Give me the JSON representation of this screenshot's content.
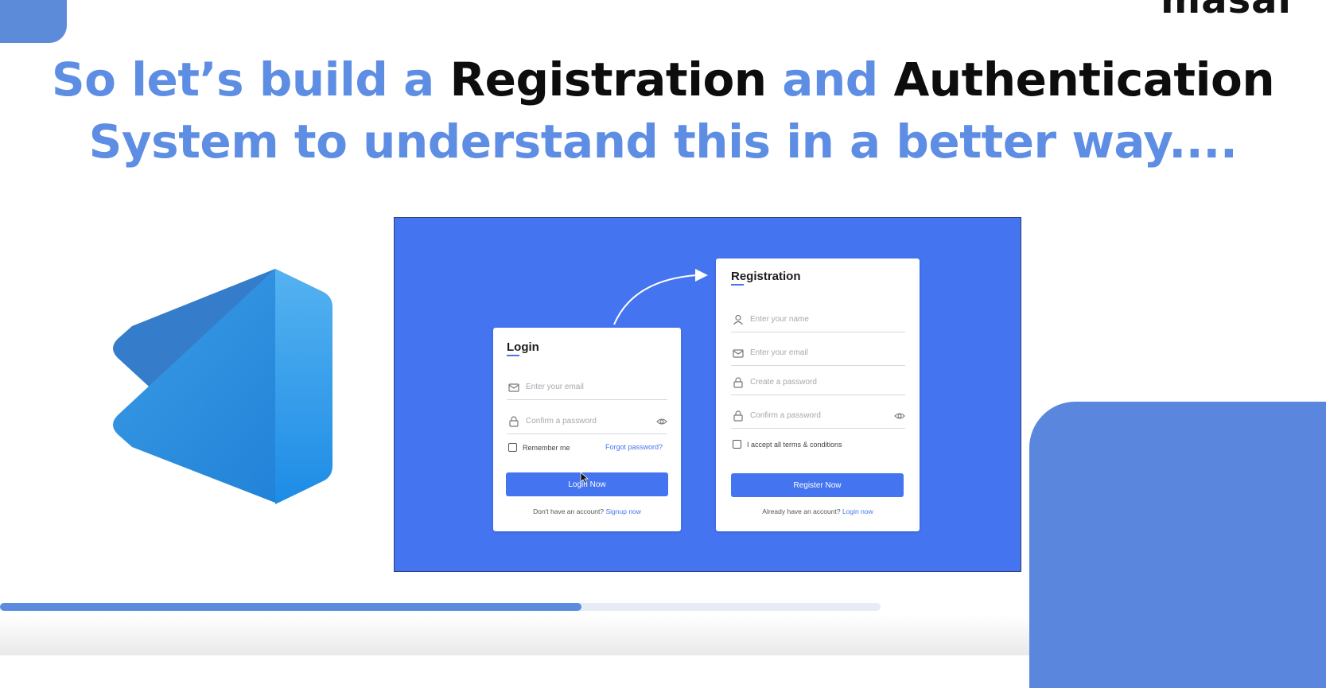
{
  "brand": {
    "name": "masai",
    "mark": "®"
  },
  "headline": {
    "line1": [
      {
        "text": "So let’s build a ",
        "color": "blue"
      },
      {
        "text": "Registration",
        "color": "black"
      },
      {
        "text": " and ",
        "color": "blue"
      },
      {
        "text": "Authentication",
        "color": "black"
      }
    ],
    "line2": "System to understand this in a better way...."
  },
  "colors": {
    "accent": "#5e8ee4",
    "panel": "#4474ef",
    "text_dark": "#0d0d0d"
  },
  "logo": {
    "icon": "vscode-logo-icon"
  },
  "login_card": {
    "title": "Login",
    "email_placeholder": "Enter your email",
    "password_placeholder": "Confirm a password",
    "remember_label": "Remember me",
    "forgot_link": "Forgot password?",
    "button_label": "Login Now",
    "footer_text": "Don't have an account?",
    "footer_link": "Signup now"
  },
  "registration_card": {
    "title": "Registration",
    "name_placeholder": "Enter your name",
    "email_placeholder": "Enter your email",
    "create_password_placeholder": "Create a password",
    "confirm_password_placeholder": "Confirm a password",
    "terms_label": "I accept all terms & conditions",
    "button_label": "Register Now",
    "footer_text": "Already  have an account?",
    "footer_link": "Login now"
  },
  "video_progress": {
    "fraction": 0.66
  }
}
